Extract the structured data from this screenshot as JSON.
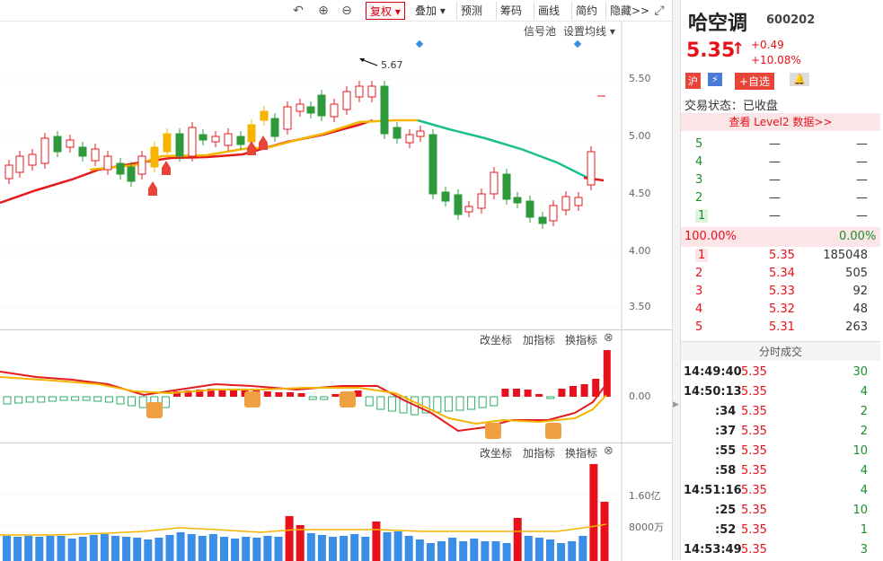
{
  "toolbar": {
    "buttons": [
      "复权",
      "叠加",
      "预测",
      "筹码",
      "画线",
      "简约",
      "隐藏>>"
    ],
    "active": "复权"
  },
  "main_chart": {
    "signal_pool": "信号池",
    "ma_settings": "设置均线",
    "max_label": "5.67",
    "price_ticks": [
      "5.50",
      "5.00",
      "4.50",
      "4.00",
      "3.50"
    ]
  },
  "indicator_panel": {
    "buttons": [
      "改坐标",
      "加指标",
      "换指标"
    ],
    "zero_label": "0.00"
  },
  "volume_panel": {
    "buttons": [
      "改坐标",
      "加指标",
      "换指标"
    ],
    "ticks": [
      "1.60亿",
      "8000万"
    ]
  },
  "stock": {
    "name": "哈空调",
    "code": "600202",
    "price": "5.35",
    "arrow": "↑",
    "change": "+0.49",
    "change_pct": "+10.08%",
    "badge_market": "沪",
    "add_watch": "+自选",
    "trade_status": "交易状态：已收盘",
    "level2": "查看 Level2 数据>>"
  },
  "orderbook": {
    "upper": [
      {
        "level": "5",
        "price": "—",
        "vol": "—"
      },
      {
        "level": "4",
        "price": "—",
        "vol": "—"
      },
      {
        "level": "3",
        "price": "—",
        "vol": "—"
      },
      {
        "level": "2",
        "price": "—",
        "vol": "—"
      },
      {
        "level": "1",
        "price": "—",
        "vol": "—"
      }
    ],
    "ratio_left": "100.00%",
    "ratio_right": "0.00%",
    "lower": [
      {
        "level": "1",
        "price": "5.35",
        "vol": "185048"
      },
      {
        "level": "2",
        "price": "5.34",
        "vol": "505"
      },
      {
        "level": "3",
        "price": "5.33",
        "vol": "92"
      },
      {
        "level": "4",
        "price": "5.32",
        "vol": "48"
      },
      {
        "level": "5",
        "price": "5.31",
        "vol": "263"
      }
    ]
  },
  "ticks_title": "分时成交",
  "trades": [
    {
      "time": "14:49:40",
      "price": "5.35",
      "vol": "30"
    },
    {
      "time": "14:50:13",
      "price": "5.35",
      "vol": "4"
    },
    {
      "time": ":34",
      "price": "5.35",
      "vol": "2"
    },
    {
      "time": ":37",
      "price": "5.35",
      "vol": "2"
    },
    {
      "time": ":55",
      "price": "5.35",
      "vol": "10"
    },
    {
      "time": ":58",
      "price": "5.35",
      "vol": "4"
    },
    {
      "time": "14:51:16",
      "price": "5.35",
      "vol": "4"
    },
    {
      "time": ":25",
      "price": "5.35",
      "vol": "10"
    },
    {
      "time": ":52",
      "price": "5.35",
      "vol": "1"
    },
    {
      "time": "14:53:49",
      "price": "5.35",
      "vol": "3"
    }
  ]
}
